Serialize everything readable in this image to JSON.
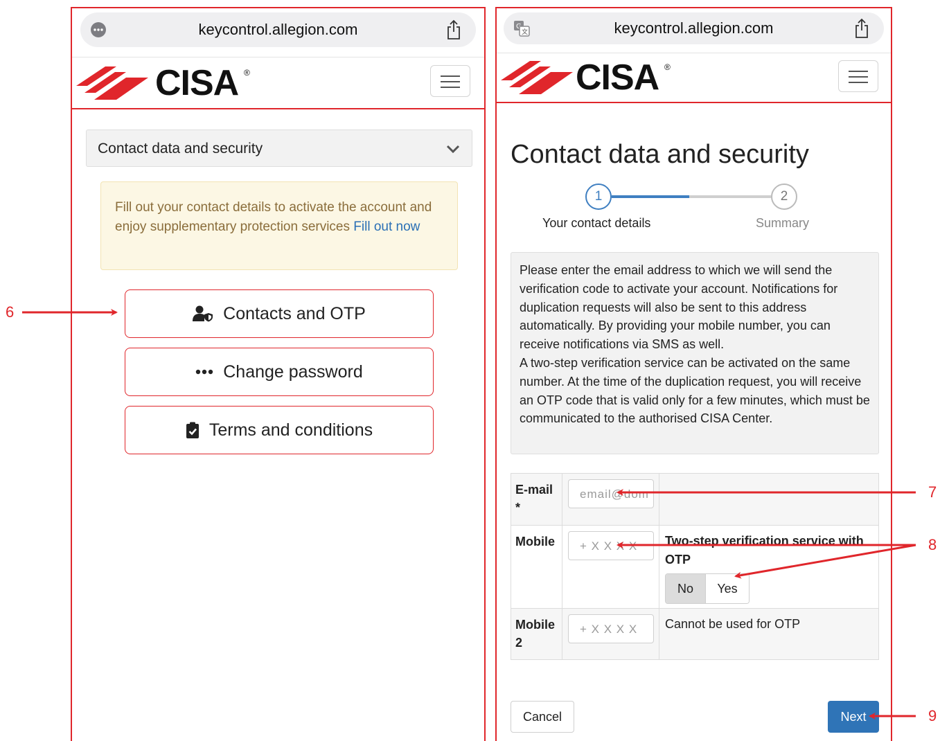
{
  "left": {
    "url": "keycontrol.allegion.com",
    "brand": "CISA",
    "section_select": "Contact data and security",
    "alert_text": "Fill out your contact details to activate the account and enjoy supplementary protection services",
    "alert_link": "Fill out now",
    "buttons": [
      {
        "label": "Contacts and OTP",
        "icon": "user-shield-icon"
      },
      {
        "label": "Change password",
        "icon": "ellipsis-icon"
      },
      {
        "label": "Terms and conditions",
        "icon": "clipboard-check-icon"
      }
    ]
  },
  "right": {
    "url": "keycontrol.allegion.com",
    "brand": "CISA",
    "title": "Contact data and security",
    "steps": [
      {
        "number": "1",
        "label": "Your contact details"
      },
      {
        "number": "2",
        "label": "Summary"
      }
    ],
    "info_line1": "Please enter the email address to which we will send the verification code to activate your account. Notifications for duplication requests will also be sent to this address automatically. By providing your mobile number, you can receive notifications via SMS as well.",
    "info_line2": "A two-step verification service can be activated on the same number. At the time of the duplication request, you will receive an OTP code that is valid only for a few minutes, which must be communicated to the authorised CISA Center.",
    "form": {
      "email_label": "E-mail",
      "email_required": "*",
      "email_placeholder": "email@dom",
      "mobile_label": "Mobile",
      "mobile_placeholder": "+ X X X X",
      "otp_label": "Two-step verification service with OTP",
      "otp_no": "No",
      "otp_yes": "Yes",
      "mobile2_label": "Mobile 2",
      "mobile2_placeholder": "+ X X X X",
      "mobile2_note": "Cannot be used for OTP"
    },
    "cancel": "Cancel",
    "next": "Next"
  },
  "annotations": [
    "6",
    "7",
    "8",
    "9"
  ],
  "colors": {
    "accent": "#e0262b",
    "primary": "#2f74b7",
    "alert_bg": "#fcf7e4",
    "alert_text": "#8a6d3b"
  }
}
